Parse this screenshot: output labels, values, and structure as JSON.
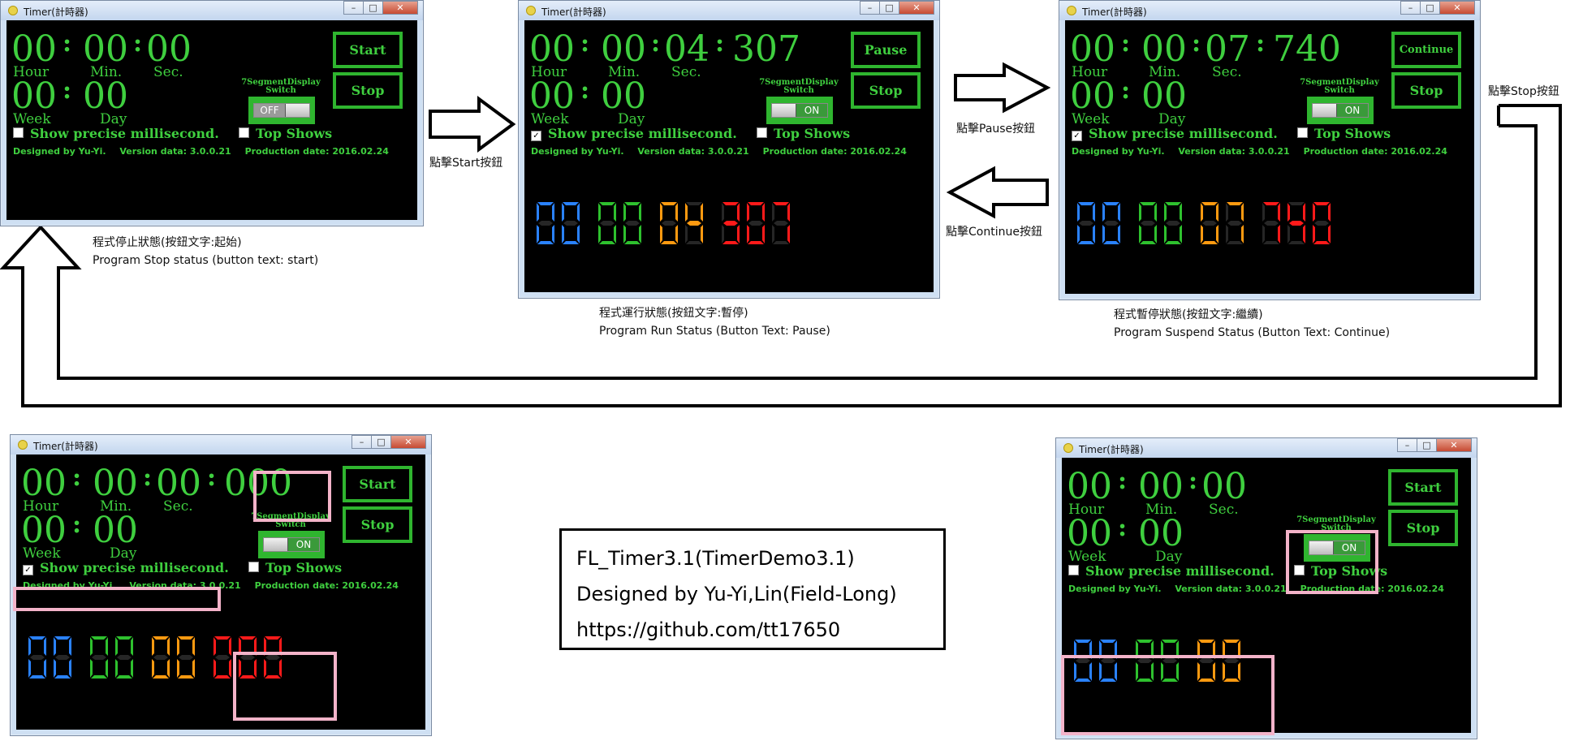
{
  "window_title": "Timer(計時器)",
  "labels": {
    "hour": "Hour",
    "min": "Min.",
    "sec": "Sec.",
    "week": "Week",
    "day": "Day"
  },
  "switch_label_line1": "7SegmentDisplay",
  "switch_label_line2": "Switch",
  "check_precise": "Show precise millisecond.",
  "check_top": "Top Shows",
  "info": {
    "designer": "Designed by Yu-Yi.",
    "version": "Version data: 3.0.0.21",
    "production": "Production date: 2016.02.24"
  },
  "colors": {
    "green": "#3fcf3f",
    "seg_blue": "#2a82ff",
    "seg_green": "#2ec12e",
    "seg_orange": "#ff9a10",
    "seg_red": "#ff1a1a",
    "seg_off": "#262626",
    "pink": "#f3b3c9"
  },
  "windows": [
    {
      "id": "stop",
      "hour": "00",
      "min": "00",
      "sec": "00",
      "ms": "",
      "week": "00",
      "day": "00",
      "button1": "Start",
      "button2": "Stop",
      "switch_state": "OFF",
      "precise_checked": false,
      "top_checked": false,
      "seg": ""
    },
    {
      "id": "run",
      "hour": "00",
      "min": "00",
      "sec": "04",
      "ms": "307",
      "week": "00",
      "day": "00",
      "button1": "Pause",
      "button2": "Stop",
      "switch_state": "ON",
      "precise_checked": true,
      "top_checked": false,
      "seg": "00 00 04 307"
    },
    {
      "id": "suspend",
      "hour": "00",
      "min": "00",
      "sec": "07",
      "ms": "740",
      "week": "00",
      "day": "00",
      "button1": "Continue",
      "button2": "Stop",
      "switch_state": "ON",
      "precise_checked": true,
      "top_checked": false,
      "seg": "00 00 07 740"
    },
    {
      "id": "precise",
      "hour": "00",
      "min": "00",
      "sec": "00",
      "ms": "000",
      "week": "00",
      "day": "00",
      "button1": "Start",
      "button2": "Stop",
      "switch_state": "ON",
      "precise_checked": true,
      "top_checked": false,
      "seg": "00 00 00 000"
    },
    {
      "id": "segment",
      "hour": "00",
      "min": "00",
      "sec": "00",
      "ms": "",
      "week": "00",
      "day": "00",
      "button1": "Start",
      "button2": "Stop",
      "switch_state": "ON",
      "precise_checked": false,
      "top_checked": false,
      "seg": "00 00 00"
    }
  ],
  "captions": {
    "stop_zh": "程式停止狀態(按鈕文字:起始)",
    "stop_en": "Program Stop status (button text: start)",
    "run_zh": "程式運行狀態(按鈕文字:暫停)",
    "run_en": "Program Run Status (Button Text: Pause)",
    "suspend_zh": "程式暫停狀態(按鈕文字:繼續)",
    "suspend_en": "Program Suspend Status (Button Text: Continue)"
  },
  "arrows": {
    "start": "點擊Start按鈕",
    "pause": "點擊Pause按鈕",
    "continue": "點擊Continue按鈕",
    "stop": "點擊Stop按鈕"
  },
  "titlebox": {
    "line1": "FL_Timer3.1(TimerDemo3.1)",
    "line2": "Designed by Yu-Yi,Lin(Field-Long)",
    "line3": "https://github.com/tt17650"
  }
}
